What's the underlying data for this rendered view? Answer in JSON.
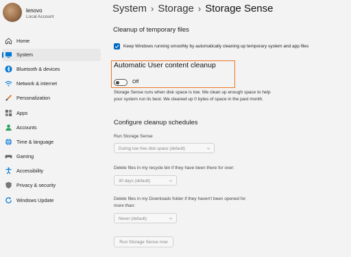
{
  "profile": {
    "name": "lenovo",
    "account_type": "Local Account"
  },
  "sidebar": {
    "items": [
      {
        "label": "Home",
        "icon": "home-icon",
        "active": false
      },
      {
        "label": "System",
        "icon": "system-icon",
        "active": true
      },
      {
        "label": "Bluetooth & devices",
        "icon": "bluetooth-icon",
        "active": false
      },
      {
        "label": "Network & internet",
        "icon": "wifi-icon",
        "active": false
      },
      {
        "label": "Personalization",
        "icon": "brush-icon",
        "active": false
      },
      {
        "label": "Apps",
        "icon": "apps-icon",
        "active": false
      },
      {
        "label": "Accounts",
        "icon": "accounts-icon",
        "active": false
      },
      {
        "label": "Time & language",
        "icon": "globe-clock-icon",
        "active": false
      },
      {
        "label": "Gaming",
        "icon": "gaming-icon",
        "active": false
      },
      {
        "label": "Accessibility",
        "icon": "accessibility-icon",
        "active": false
      },
      {
        "label": "Privacy & security",
        "icon": "shield-icon",
        "active": false
      },
      {
        "label": "Windows Update",
        "icon": "update-icon",
        "active": false
      }
    ]
  },
  "breadcrumb": {
    "level1": "System",
    "level2": "Storage",
    "current": "Storage Sense",
    "separator": "›"
  },
  "cleanup_temp": {
    "title": "Cleanup of temporary files",
    "checkbox_label": "Keep Windows running smoothly by automatically cleaning up temporary system and app files",
    "checked": true
  },
  "auto_cleanup": {
    "title": "Automatic User content cleanup",
    "toggle_state": "Off",
    "description": "Storage Sense runs when disk space is low. We clean up enough space to help your system run its best. We cleaned up 0 bytes of space in the past month."
  },
  "schedules": {
    "title": "Configure cleanup schedules",
    "run_label": "Run Storage Sense",
    "run_value": "During low free disk space (default)",
    "recycle_label": "Delete files in my recycle bin if they have been there for over:",
    "recycle_value": "30 days (default)",
    "downloads_label_line1": "Delete files in my Downloads folder if they haven't been opened for",
    "downloads_label_line2": "more than:",
    "downloads_value": "Never (default)",
    "run_now_button": "Run Storage Sense now"
  },
  "colors": {
    "accent": "#0067c0",
    "highlight": "#e87722",
    "background": "#f3f3f3"
  }
}
